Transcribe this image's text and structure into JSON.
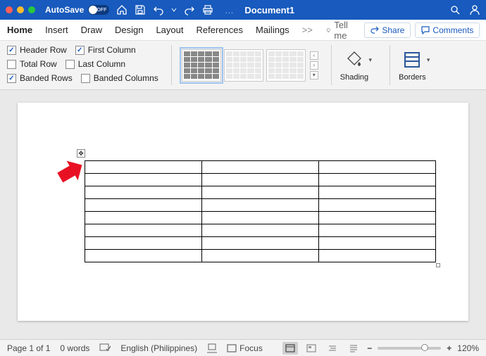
{
  "titlebar": {
    "autosave_label": "AutoSave",
    "autosave_state": "OFF",
    "document_title": "Document1"
  },
  "tabs": {
    "items": [
      "Home",
      "Insert",
      "Draw",
      "Design",
      "Layout",
      "References",
      "Mailings"
    ],
    "tell_me": "Tell me",
    "share": "Share",
    "comments": "Comments"
  },
  "ribbon": {
    "options": {
      "header_row": {
        "label": "Header Row",
        "checked": true
      },
      "total_row": {
        "label": "Total Row",
        "checked": false
      },
      "banded_rows": {
        "label": "Banded Rows",
        "checked": true
      },
      "first_column": {
        "label": "First Column",
        "checked": true
      },
      "last_column": {
        "label": "Last Column",
        "checked": false
      },
      "banded_columns": {
        "label": "Banded Columns",
        "checked": false
      }
    },
    "shading": "Shading",
    "borders": "Borders"
  },
  "document": {
    "table": {
      "rows": 8,
      "cols": 3
    }
  },
  "statusbar": {
    "page": "Page 1 of 1",
    "words": "0 words",
    "language": "English (Philippines)",
    "focus": "Focus",
    "zoom": "120%"
  }
}
